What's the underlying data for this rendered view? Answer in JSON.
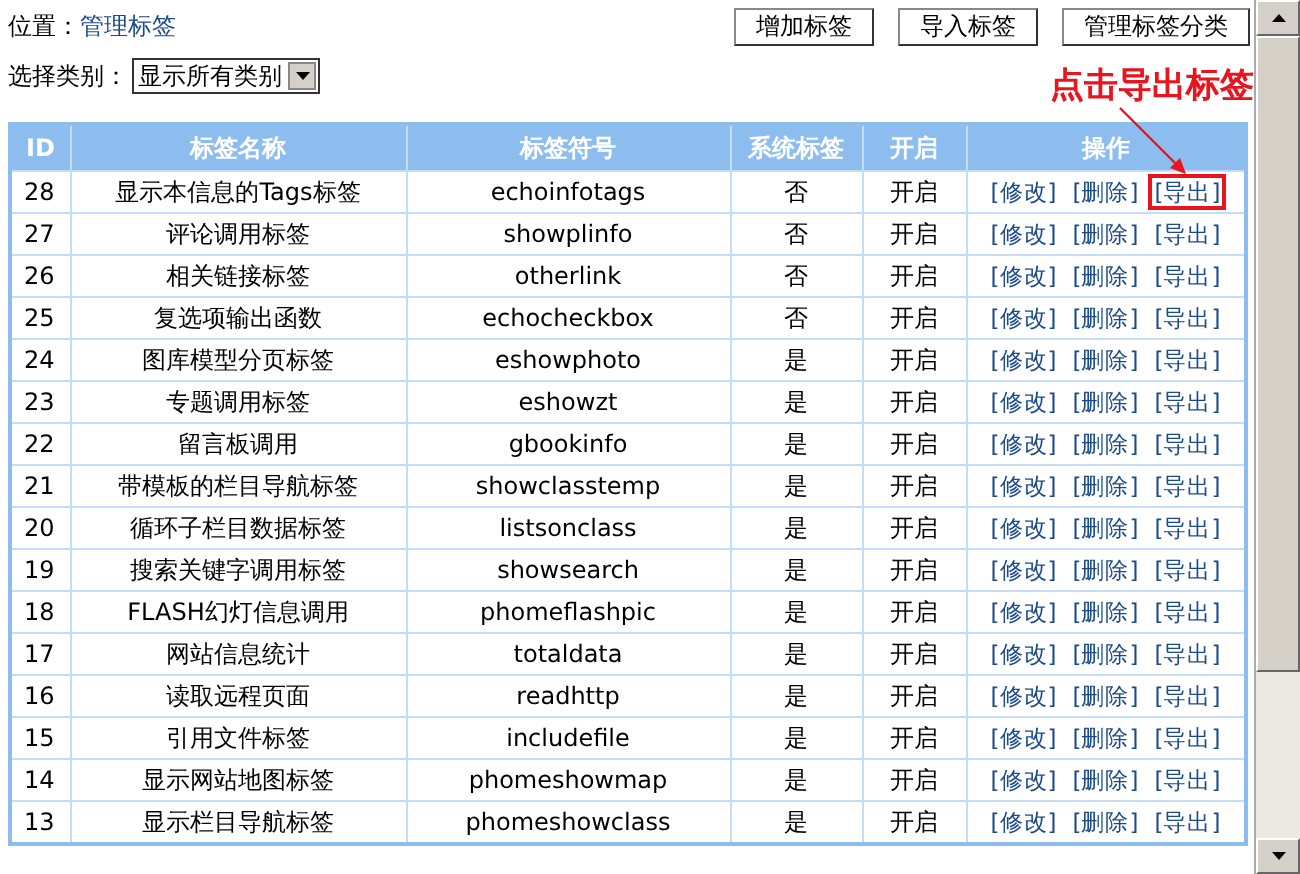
{
  "breadcrumb": {
    "label": "位置：",
    "link": "管理标签"
  },
  "buttons": [
    "增加标签",
    "导入标签",
    "管理标签分类"
  ],
  "filter": {
    "label": "选择类别：",
    "value": "显示所有类别"
  },
  "annotation": "点击导出标签",
  "table": {
    "columns": [
      "ID",
      "标签名称",
      "标签符号",
      "系统标签",
      "开启",
      "操作"
    ],
    "rows": [
      {
        "id": "28",
        "name": "显示本信息的Tags标签",
        "symbol": "echoinfotags",
        "system": "否",
        "status": "开启",
        "actions": [
          "[修改]",
          "[删除]",
          "[导出]"
        ],
        "highlighted": true
      },
      {
        "id": "27",
        "name": "评论调用标签",
        "symbol": "showplinfo",
        "system": "否",
        "status": "开启",
        "actions": [
          "[修改]",
          "[删除]",
          "[导出]"
        ],
        "highlighted": false
      },
      {
        "id": "26",
        "name": "相关链接标签",
        "symbol": "otherlink",
        "system": "否",
        "status": "开启",
        "actions": [
          "[修改]",
          "[删除]",
          "[导出]"
        ],
        "highlighted": false
      },
      {
        "id": "25",
        "name": "复选项输出函数",
        "symbol": "echocheckbox",
        "system": "否",
        "status": "开启",
        "actions": [
          "[修改]",
          "[删除]",
          "[导出]"
        ],
        "highlighted": false
      },
      {
        "id": "24",
        "name": "图库模型分页标签",
        "symbol": "eshowphoto",
        "system": "是",
        "status": "开启",
        "actions": [
          "[修改]",
          "[删除]",
          "[导出]"
        ],
        "highlighted": false
      },
      {
        "id": "23",
        "name": "专题调用标签",
        "symbol": "eshowzt",
        "system": "是",
        "status": "开启",
        "actions": [
          "[修改]",
          "[删除]",
          "[导出]"
        ],
        "highlighted": false
      },
      {
        "id": "22",
        "name": "留言板调用",
        "symbol": "gbookinfo",
        "system": "是",
        "status": "开启",
        "actions": [
          "[修改]",
          "[删除]",
          "[导出]"
        ],
        "highlighted": false
      },
      {
        "id": "21",
        "name": "带模板的栏目导航标签",
        "symbol": "showclasstemp",
        "system": "是",
        "status": "开启",
        "actions": [
          "[修改]",
          "[删除]",
          "[导出]"
        ],
        "highlighted": false
      },
      {
        "id": "20",
        "name": "循环子栏目数据标签",
        "symbol": "listsonclass",
        "system": "是",
        "status": "开启",
        "actions": [
          "[修改]",
          "[删除]",
          "[导出]"
        ],
        "highlighted": false
      },
      {
        "id": "19",
        "name": "搜索关键字调用标签",
        "symbol": "showsearch",
        "system": "是",
        "status": "开启",
        "actions": [
          "[修改]",
          "[删除]",
          "[导出]"
        ],
        "highlighted": false
      },
      {
        "id": "18",
        "name": "FLASH幻灯信息调用",
        "symbol": "phomeflashpic",
        "system": "是",
        "status": "开启",
        "actions": [
          "[修改]",
          "[删除]",
          "[导出]"
        ],
        "highlighted": false
      },
      {
        "id": "17",
        "name": "网站信息统计",
        "symbol": "totaldata",
        "system": "是",
        "status": "开启",
        "actions": [
          "[修改]",
          "[删除]",
          "[导出]"
        ],
        "highlighted": false
      },
      {
        "id": "16",
        "name": "读取远程页面",
        "symbol": "readhttp",
        "system": "是",
        "status": "开启",
        "actions": [
          "[修改]",
          "[删除]",
          "[导出]"
        ],
        "highlighted": false
      },
      {
        "id": "15",
        "name": "引用文件标签",
        "symbol": "includefile",
        "system": "是",
        "status": "开启",
        "actions": [
          "[修改]",
          "[删除]",
          "[导出]"
        ],
        "highlighted": false
      },
      {
        "id": "14",
        "name": "显示网站地图标签",
        "symbol": "phomeshowmap",
        "system": "是",
        "status": "开启",
        "actions": [
          "[修改]",
          "[删除]",
          "[导出]"
        ],
        "highlighted": false
      },
      {
        "id": "13",
        "name": "显示栏目导航标签",
        "symbol": "phomeshowclass",
        "system": "是",
        "status": "开启",
        "actions": [
          "[修改]",
          "[删除]",
          "[导出]"
        ],
        "highlighted": false
      }
    ]
  }
}
